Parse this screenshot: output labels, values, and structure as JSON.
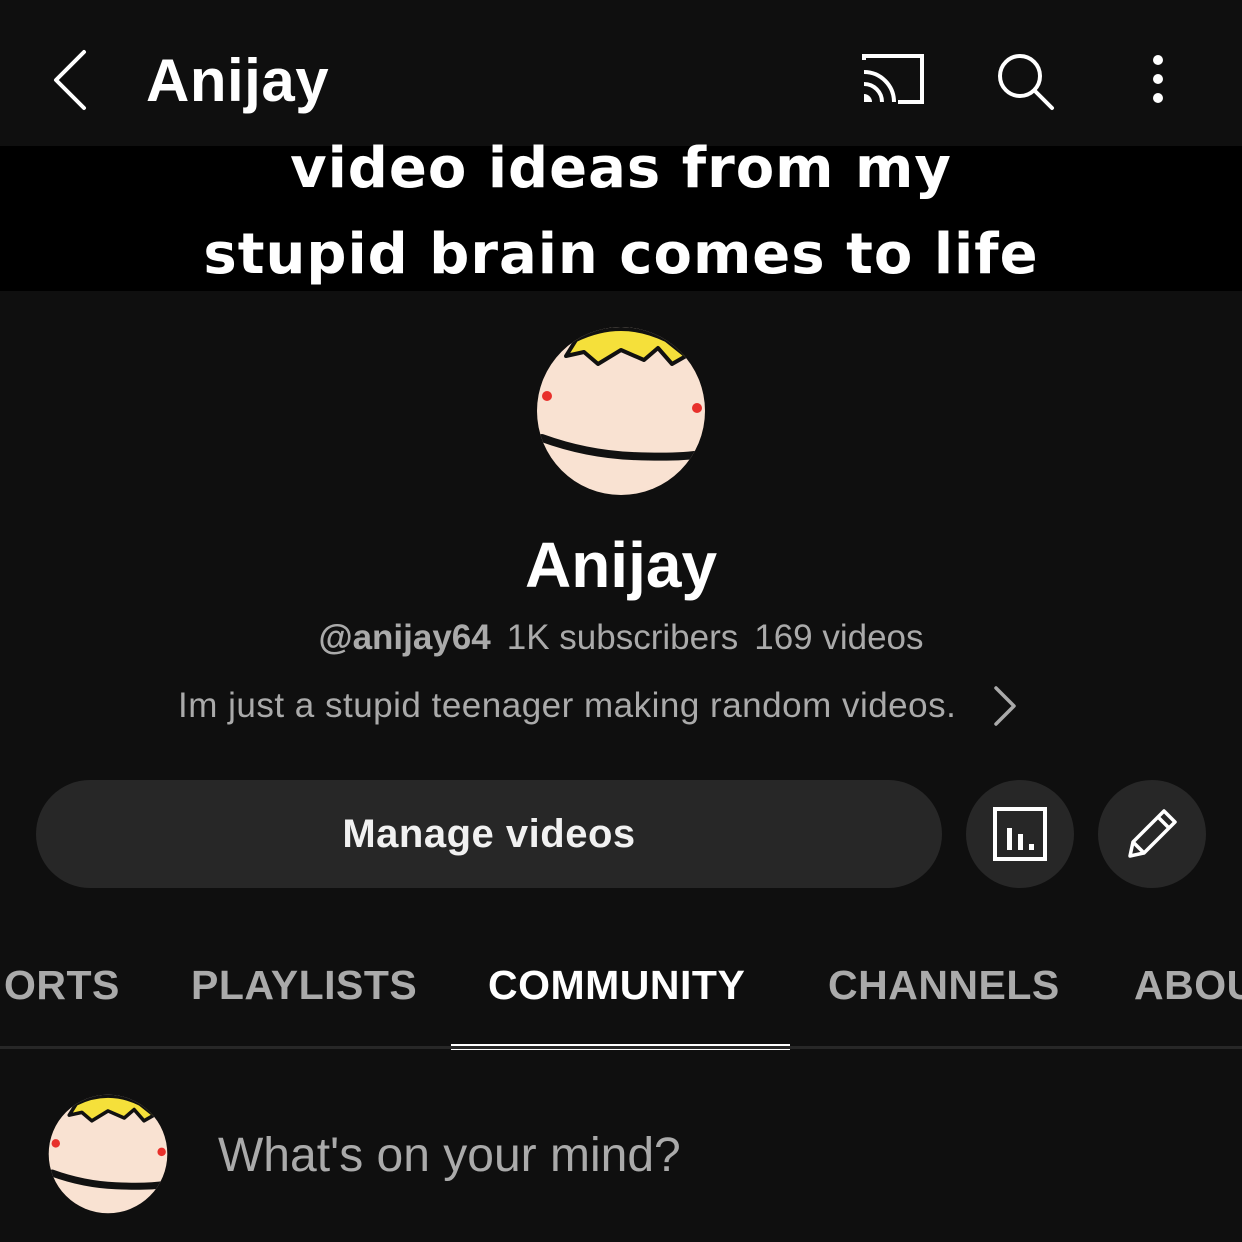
{
  "topbar": {
    "title": "Anijay",
    "back_icon": "chevron-left-icon",
    "cast_icon": "cast-icon",
    "search_icon": "search-icon",
    "more_icon": "more-vertical-icon"
  },
  "banner": {
    "line1": "video ideas from my",
    "line2": "stupid brain comes to life"
  },
  "channel": {
    "name": "Anijay",
    "handle": "@anijay64",
    "subscribers": "1K subscribers",
    "videos": "169 videos",
    "description": "Im just a stupid teenager making random videos."
  },
  "actions": {
    "manage_label": "Manage videos",
    "analytics_icon": "analytics-icon",
    "edit_icon": "pencil-icon"
  },
  "tabs": [
    {
      "label": "ORTS",
      "active": false
    },
    {
      "label": "PLAYLISTS",
      "active": false
    },
    {
      "label": "COMMUNITY",
      "active": true
    },
    {
      "label": "CHANNELS",
      "active": false
    },
    {
      "label": "ABOU",
      "active": false
    }
  ],
  "composer": {
    "placeholder": "What's on your mind?"
  },
  "colors": {
    "background": "#0f0f0f",
    "surface": "#272727",
    "text_secondary": "#aaaaaa",
    "avatar_skin": "#f9e2d2",
    "avatar_hair": "#f5e03a",
    "avatar_dot": "#e8302b"
  }
}
